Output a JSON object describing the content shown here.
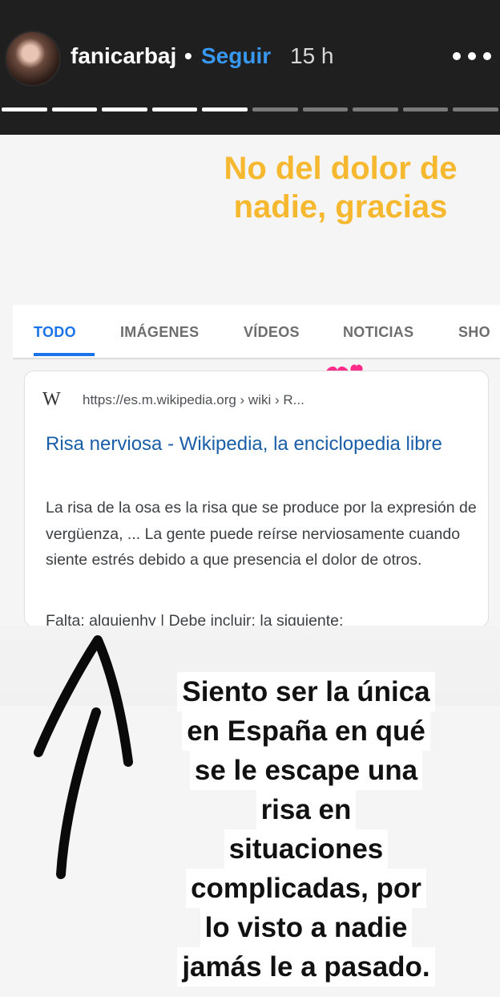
{
  "header": {
    "username": "fanicarbaj",
    "separator": "•",
    "follow_label": "Seguir",
    "time": "15 h",
    "progress_segments": 10,
    "progress_done": 5
  },
  "story": {
    "sticker_top_lines": [
      "No del dolor de",
      "nadie, gracias"
    ],
    "tabs": [
      "TODO",
      "IMÁGENES",
      "VÍDEOS",
      "NOTICIAS",
      "SHO"
    ],
    "active_tab": "TODO",
    "result": {
      "icon_glyph": "W",
      "url": "https://es.m.wikipedia.org › wiki › R...",
      "title": "Risa nerviosa - Wikipedia, la enciclopedia libre",
      "snippet": "La risa de la osa es la risa que se produce por la expresión de vergüenza, ... La gente puede reírse nerviosamente cuando siente estrés debido a que presencia el dolor de otros.",
      "snippet_cut": "Falta: alguienhy | Debe incluir: la siguiente:"
    },
    "caption_lines": [
      "Siento ser la única",
      "en España en qué",
      "se le escape una",
      "risa en",
      "situaciones",
      "complicadas, por",
      "lo visto a nadie",
      "jamás le a pasado."
    ]
  },
  "colors": {
    "follow": "#3897f0",
    "sticker": "#f5b82e",
    "link": "#1a5ea8",
    "active_tab": "#1a73e8"
  }
}
